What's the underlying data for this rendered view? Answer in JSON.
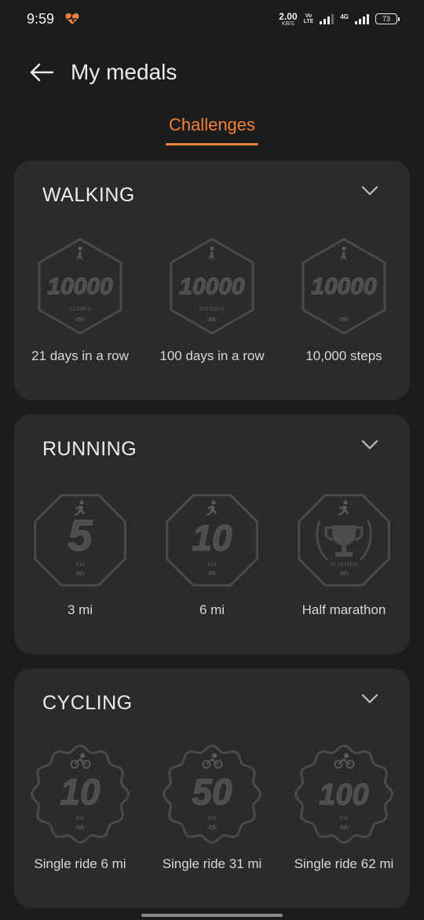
{
  "status_bar": {
    "time": "9:59",
    "speed_value": "2.00",
    "speed_unit": "KB/S",
    "volte_top": "Vo",
    "volte_bottom": "LTE",
    "net_type": "4G",
    "battery": "73"
  },
  "header": {
    "title": "My medals"
  },
  "tabs": {
    "active_label": "Challenges"
  },
  "colors": {
    "accent": "#f0803c",
    "card_bg": "#2b2b2b",
    "page_bg": "#1c1c1c"
  },
  "sections": [
    {
      "title": "WALKING",
      "medals": [
        {
          "label": "21 days in a row",
          "badge_number": "10000",
          "badge_sub": "21 DAYS"
        },
        {
          "label": "100 days in a row",
          "badge_number": "10000",
          "badge_sub": "100 DAYS"
        },
        {
          "label": "10,000 steps",
          "badge_number": "10000",
          "badge_sub": ""
        }
      ]
    },
    {
      "title": "RUNNING",
      "medals": [
        {
          "label": "3 mi",
          "badge_number": "5",
          "badge_sub": "KM"
        },
        {
          "label": "6 mi",
          "badge_number": "10",
          "badge_sub": "KM"
        },
        {
          "label": "Half marathon",
          "badge_number": "",
          "badge_sub": "21.0975KM"
        }
      ]
    },
    {
      "title": "CYCLING",
      "medals": [
        {
          "label": "Single ride 6 mi",
          "badge_number": "10",
          "badge_sub": "KM"
        },
        {
          "label": "Single ride 31 mi",
          "badge_number": "50",
          "badge_sub": "KM"
        },
        {
          "label": "Single ride 62 mi",
          "badge_number": "100",
          "badge_sub": "KM"
        }
      ]
    }
  ]
}
